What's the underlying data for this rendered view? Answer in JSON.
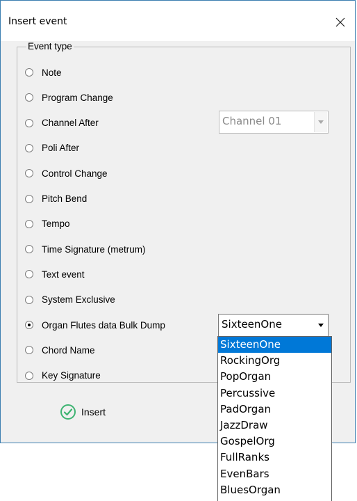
{
  "window": {
    "title": "Insert event",
    "close_glyph": "✕"
  },
  "event_type": {
    "legend": "Event type",
    "options": [
      {
        "label": "Note",
        "checked": false
      },
      {
        "label": "Program Change",
        "checked": false
      },
      {
        "label": "Channel After",
        "checked": false
      },
      {
        "label": "Poli After",
        "checked": false
      },
      {
        "label": "Control Change",
        "checked": false
      },
      {
        "label": "Pitch Bend",
        "checked": false
      },
      {
        "label": "Tempo",
        "checked": false
      },
      {
        "label": "Time Signature (metrum)",
        "checked": false
      },
      {
        "label": "Text event",
        "checked": false
      },
      {
        "label": "System Exclusive",
        "checked": false
      },
      {
        "label": "Organ Flutes data Bulk Dump",
        "checked": true
      },
      {
        "label": "Chord Name",
        "checked": false
      },
      {
        "label": "Key Signature",
        "checked": false
      }
    ]
  },
  "channel_combo": {
    "value": "Channel 01",
    "enabled": false,
    "icon": "chevron-down-icon"
  },
  "preset_combo": {
    "value": "SixteenOne",
    "enabled": true,
    "icon": "chevron-down-icon",
    "options": [
      "SixteenOne",
      "RockingOrg",
      "PopOrgan",
      "Percussive",
      "PadOrgan",
      "JazzDraw",
      "GospelOrg",
      "FullRanks",
      "EvenBars",
      "BluesOrgan"
    ],
    "selected": "SixteenOne"
  },
  "insert_button": {
    "label": "Insert",
    "icon": "check-circle-icon"
  },
  "colors": {
    "accent": "#0078d7",
    "check_green": "#3cb371",
    "dialog_bg": "#f0f0f0",
    "window_border": "#3c7fb1"
  }
}
